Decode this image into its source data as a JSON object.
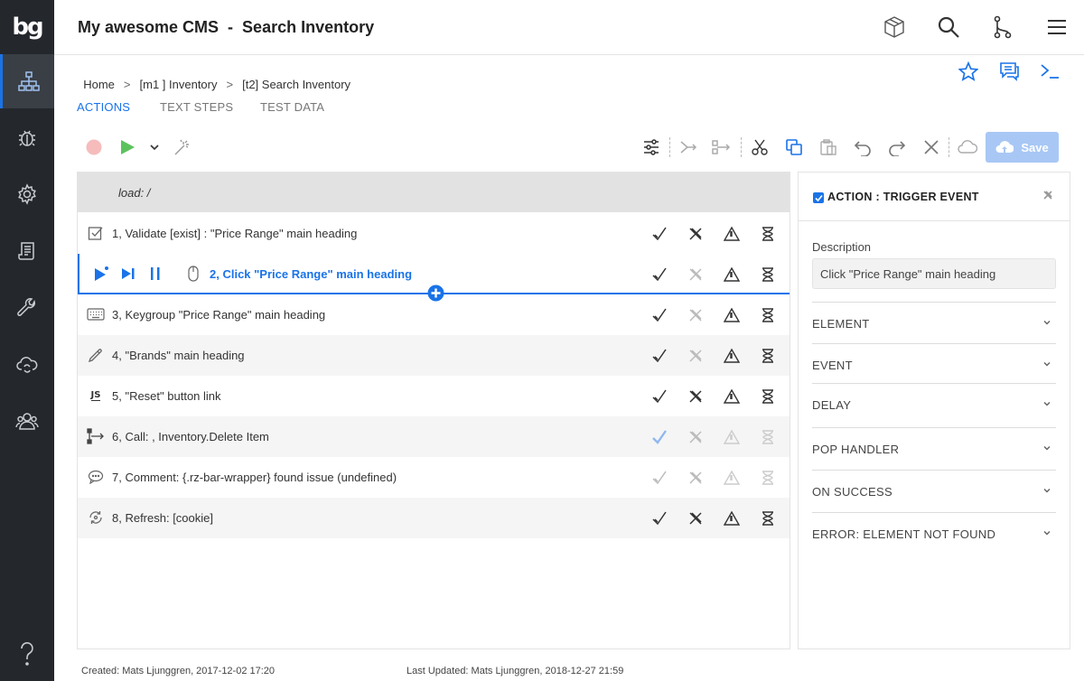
{
  "app": {
    "title": "My awesome CMS  -  Search Inventory",
    "logo_text": "bg",
    "accent": "#1a73e8",
    "sidebar_bg": "#24282d"
  },
  "sidebar": {
    "items": [
      {
        "icon": "sitemap-icon",
        "active": true
      },
      {
        "icon": "bug-icon"
      },
      {
        "icon": "gear-icon"
      },
      {
        "icon": "report-icon"
      },
      {
        "icon": "wrench-icon"
      },
      {
        "icon": "cloud-sync-icon"
      },
      {
        "icon": "users-icon"
      },
      {
        "icon": "help-icon"
      }
    ]
  },
  "header": {
    "icons": [
      "package-icon",
      "search-icon",
      "branch-icon",
      "menu-icon"
    ]
  },
  "breadcrumb": {
    "items": [
      "Home",
      "[m1 ] Inventory",
      "[t2] Search Inventory"
    ],
    "separator": ">"
  },
  "tabs": [
    {
      "label": "ACTIONS",
      "active": true
    },
    {
      "label": "TEXT STEPS"
    },
    {
      "label": "TEST DATA"
    }
  ],
  "toolbar": {
    "save_label": "Save"
  },
  "load": {
    "text": "load: /"
  },
  "steps": [
    {
      "icon": "checkbox-icon",
      "text": "1, Validate [exist] : \"Price Range\" main heading"
    },
    {
      "icon": "mouse-icon",
      "text": "2, Click \"Price Range\" main heading",
      "active": true
    },
    {
      "icon": "keyboard-icon",
      "text": "3, Keygroup \"Price Range\" main heading"
    },
    {
      "icon": "eyedropper-icon",
      "text": "4, \"Brands\" main heading"
    },
    {
      "icon": "js-icon",
      "text": "5, \"Reset\" button link",
      "icon_text": "JS"
    },
    {
      "icon": "call-icon",
      "text": "6, Call: , Inventory.Delete Item"
    },
    {
      "icon": "comment-icon",
      "text": "7, Comment: {.rz-bar-wrapper} found issue (undefined)"
    },
    {
      "icon": "refresh-icon",
      "text": "8, Refresh: [cookie]"
    }
  ],
  "panel": {
    "title": "ACTION : TRIGGER EVENT",
    "description_label": "Description",
    "description_value": "Click \"Price Range\" main heading",
    "sections": [
      "ELEMENT",
      "EVENT",
      "DELAY",
      "POP HANDLER",
      "ON SUCCESS",
      "ERROR: ELEMENT NOT FOUND"
    ]
  },
  "footer": {
    "created": "Created: Mats Ljunggren, 2017-12-02 17:20",
    "updated": "Last Updated: Mats Ljunggren, 2018-12-27 21:59"
  }
}
